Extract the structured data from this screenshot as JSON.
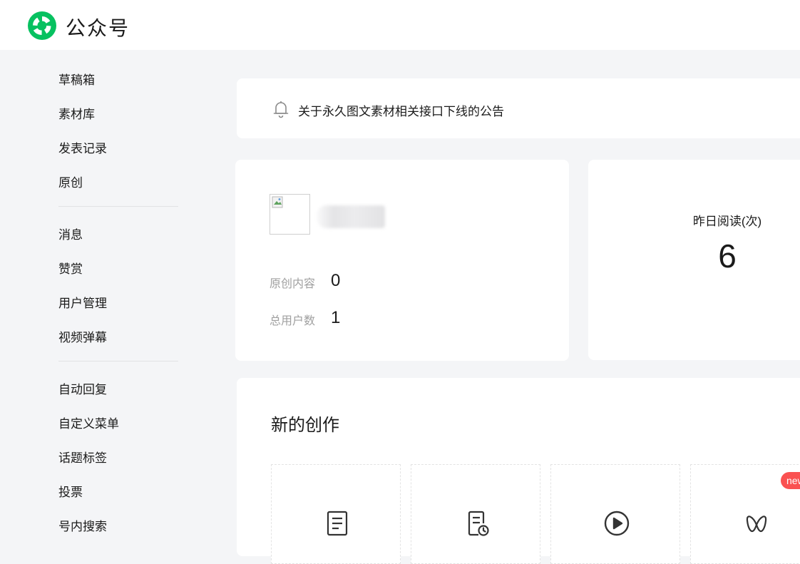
{
  "header": {
    "app_title": "公众号",
    "logo_icon": "wechat-official-accounts-logo-icon",
    "brand_color": "#07c160"
  },
  "sidebar": {
    "groups": [
      [
        "草稿箱",
        "素材库",
        "发表记录",
        "原创"
      ],
      [
        "消息",
        "赞赏",
        "用户管理",
        "视频弹幕"
      ],
      [
        "自动回复",
        "自定义菜单",
        "话题标签",
        "投票",
        "号内搜索"
      ]
    ]
  },
  "notice": {
    "icon": "bell-icon",
    "text": "关于永久图文素材相关接口下线的公告"
  },
  "account": {
    "original_label": "原创内容",
    "original_value": "0",
    "users_label": "总用户数",
    "users_value": "1"
  },
  "stats": {
    "yesterday_reads_label": "昨日阅读(次)",
    "yesterday_reads_value": "6"
  },
  "create": {
    "title": "新的创作",
    "tiles": [
      {
        "icon": "article-icon"
      },
      {
        "icon": "scheduled-article-icon"
      },
      {
        "icon": "video-play-icon"
      },
      {
        "icon": "butterfly-icon",
        "badge": "new"
      }
    ]
  },
  "colors": {
    "background": "#f4f5f7",
    "badge": "#fa5151",
    "muted_text": "#a0a0a0"
  }
}
